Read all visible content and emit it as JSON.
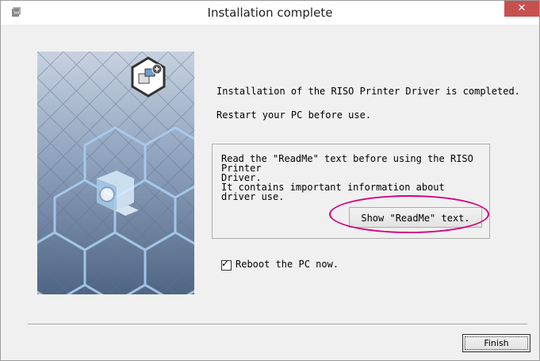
{
  "window": {
    "title": "Installation complete",
    "close_symbol": "✕"
  },
  "icons": {
    "app": "installer-app-icon",
    "close": "close-icon",
    "installer_art": "printer-install-illustration"
  },
  "main": {
    "line1": "Installation of the RISO Printer Driver is completed.",
    "line2": "Restart your PC before use."
  },
  "readme_box": {
    "line1": "Read the \"ReadMe\" text before using the RISO Printer",
    "line2": "Driver.",
    "line3": "It contains important information about driver use.",
    "button_label": "Show \"ReadMe\" text."
  },
  "reboot": {
    "checked": true,
    "label": "Reboot the PC now."
  },
  "footer": {
    "finish_label": "Finish"
  },
  "colors": {
    "highlight": "#d4007f",
    "close_button": "#c75050"
  }
}
